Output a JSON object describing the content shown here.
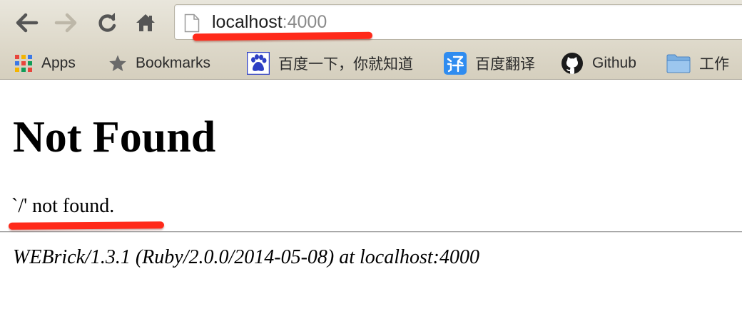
{
  "browser": {
    "url_host": "localhost",
    "url_port": ":4000",
    "icons": {
      "back": "back-arrow-icon",
      "forward": "forward-arrow-icon",
      "reload": "reload-icon",
      "home": "home-icon",
      "page": "page-icon"
    }
  },
  "bookmarks": [
    {
      "label": "Apps",
      "icon": "apps-grid-icon"
    },
    {
      "label": "Bookmarks",
      "icon": "star-icon"
    },
    {
      "label": "百度一下，你就知道",
      "icon": "baidu-paw-icon"
    },
    {
      "label": "百度翻译",
      "icon": "baidu-translate-icon"
    },
    {
      "label": "Github",
      "icon": "github-icon"
    },
    {
      "label": "工作",
      "icon": "folder-icon"
    }
  ],
  "page": {
    "title": "Not Found",
    "message": "`/' not found.",
    "server_signature": "WEBrick/1.3.1 (Ruby/2.0.0/2014-05-08) at localhost:4000"
  },
  "colors": {
    "annotation": "#ff2a1a",
    "toolbar": "#e3dfd3",
    "port_text": "#8a8a8a"
  }
}
